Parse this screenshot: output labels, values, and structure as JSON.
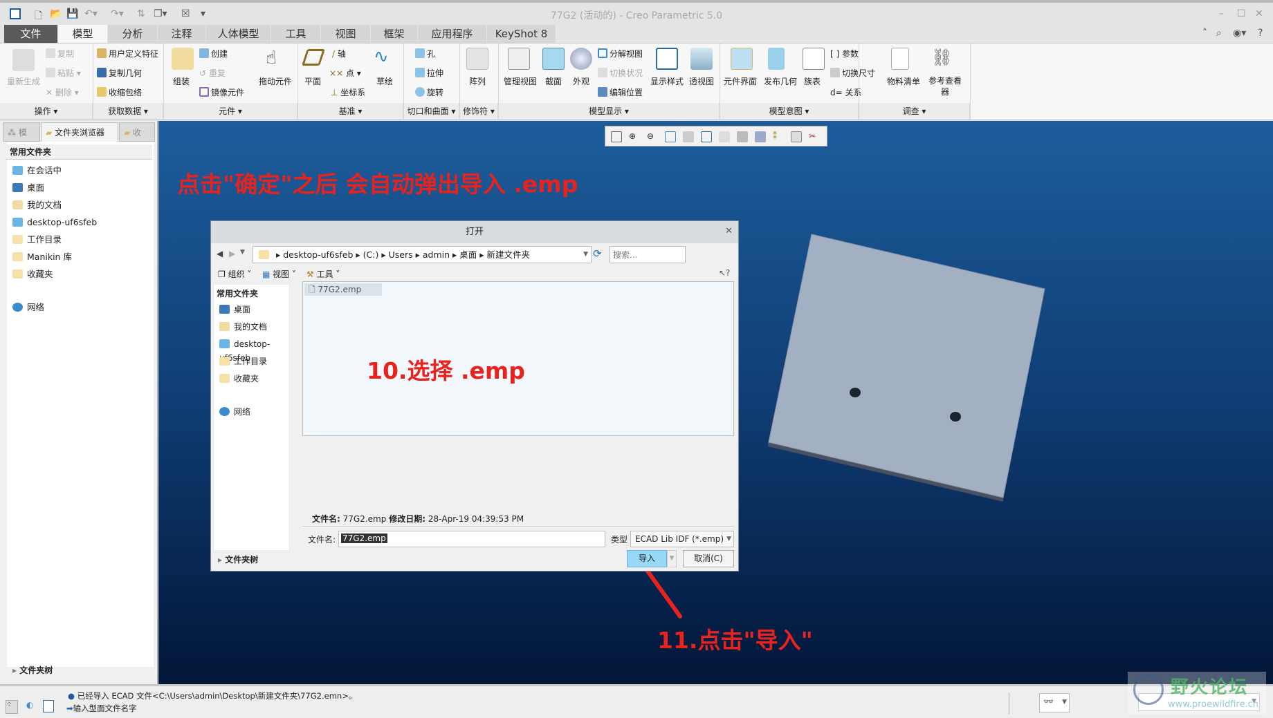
{
  "window": {
    "title": "77G2 (活动的) - Creo Parametric 5.0"
  },
  "tabs": [
    "文件",
    "模型",
    "分析",
    "注释",
    "人体模型",
    "工具",
    "视图",
    "框架",
    "应用程序",
    "KeyShot 8"
  ],
  "active_tab": "模型",
  "ribbon": {
    "ops": {
      "regen": "重新生成",
      "copy": "复制",
      "paste": "粘贴",
      "delete": "删除",
      "label": "操作"
    },
    "getdata": {
      "udf": "用户定义特征",
      "copygeom": "复制几何",
      "shrinkwrap": "收缩包络",
      "label": "获取数据"
    },
    "component": {
      "assemble": "组装",
      "create": "创建",
      "repeat": "重复",
      "mirror": "镜像元件",
      "drag": "拖动元件",
      "label": "元件"
    },
    "datum": {
      "plane": "平面",
      "axis": "轴",
      "point": "点",
      "csys": "坐标系",
      "sketch": "草绘",
      "label": "基准"
    },
    "cut": {
      "hole": "孔",
      "extrude": "拉伸",
      "revolve": "旋转",
      "label": "切口和曲面"
    },
    "modifiers": {
      "pattern": "阵列",
      "label": "修饰符"
    },
    "display": {
      "manage": "管理视图",
      "section": "截面",
      "appearance": "外观",
      "explode": "分解视图",
      "toggle": "切换状况",
      "editpos": "编辑位置",
      "style": "显示样式",
      "perspective": "透视图",
      "label": "模型显示"
    },
    "intent": {
      "interface": "元件界面",
      "publish": "发布几何",
      "family": "族表",
      "params": "参数",
      "switchdim": "切换尺寸",
      "relations": "关系",
      "label": "模型意图"
    },
    "investigate": {
      "bom": "物料清单",
      "refviewer": "参考查看器",
      "label": "调查"
    }
  },
  "left_panel": {
    "tabs": [
      "模",
      "文件夹浏览器",
      "收"
    ],
    "section": "常用文件夹",
    "items": [
      "在会话中",
      "桌面",
      "我的文档",
      "desktop-uf6sfeb",
      "工作目录",
      "Manikin 库",
      "收藏夹",
      "网络"
    ],
    "footer": "文件夹树"
  },
  "annotations": {
    "top": "点击\"确定\"之后  会自动弹出导入  .emp",
    "step10": "10.选择 .emp",
    "step11": "11.点击\"导入\""
  },
  "dialog": {
    "title": "打开",
    "path": [
      "desktop-uf6sfeb",
      "(C:)",
      "Users",
      "admin",
      "桌面",
      "新建文件夹"
    ],
    "search_placeholder": "搜索...",
    "toolbar": {
      "organize": "组织",
      "view": "视图",
      "tools": "工具"
    },
    "sidebar_section": "常用文件夹",
    "sidebar": [
      "桌面",
      "我的文档",
      "desktop-uf6sfeb",
      "工作目录",
      "收藏夹",
      "网络"
    ],
    "files": [
      "77G2.emp"
    ],
    "info_name_label": "文件名:",
    "info_name": "77G2.emp",
    "info_date_label": "修改日期:",
    "info_date": "28-Apr-19 04:39:53 PM",
    "filename_label": "文件名:",
    "filename_value": "77G2.emp",
    "type_label": "类型",
    "type_value": "ECAD Lib IDF (*.emp)",
    "folder_tree": "文件夹树",
    "import": "导入",
    "cancel": "取消(C)"
  },
  "status": {
    "message": "已经导入 ECAD 文件<C:\\Users\\admin\\Desktop\\新建文件夹\\77G2.emn>。",
    "prompt": "输入型面文件名字"
  },
  "watermark": {
    "name": "野火论坛",
    "url": "www.proewildfire.cn"
  },
  "colors": {
    "annotation": "#e8231e",
    "viewport_top": "#1d5d9c",
    "viewport_bottom": "#021638",
    "part": "#a3afc2"
  }
}
